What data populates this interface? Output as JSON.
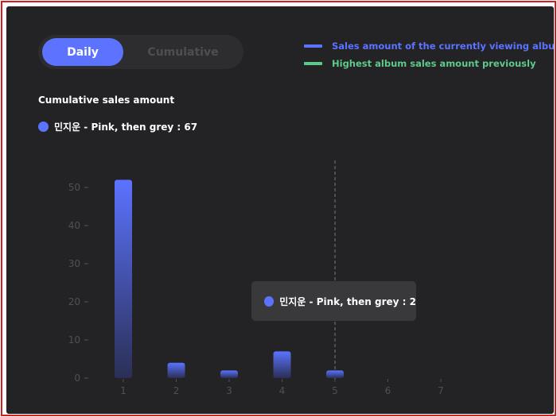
{
  "toggle": {
    "daily_label": "Daily",
    "cumulative_label": "Cumulative",
    "selected": "Daily"
  },
  "legend": [
    {
      "label": "Sales amount of the currently viewing album",
      "color": "#5b73ff"
    },
    {
      "label": "Highest album sales amount previously",
      "color": "#5ec98a"
    }
  ],
  "section_title": "Cumulative sales amount",
  "series_label": "민지운 - Pink, then grey : 67",
  "tooltip": {
    "text": "민지운 - Pink, then grey : 2"
  },
  "chart_data": {
    "type": "bar",
    "title": "Cumulative sales amount",
    "xlabel": "",
    "ylabel": "",
    "categories": [
      "1",
      "2",
      "3",
      "4",
      "5",
      "6",
      "7"
    ],
    "series": [
      {
        "name": "민지운 - Pink, then grey",
        "values": [
          52,
          4,
          2,
          7,
          2,
          null,
          null
        ],
        "color": "#5b73ff"
      }
    ],
    "ylim": [
      0,
      55
    ],
    "yticks": [
      0,
      10,
      20,
      30,
      40,
      50
    ],
    "grid": false,
    "highlight_category": "5"
  }
}
